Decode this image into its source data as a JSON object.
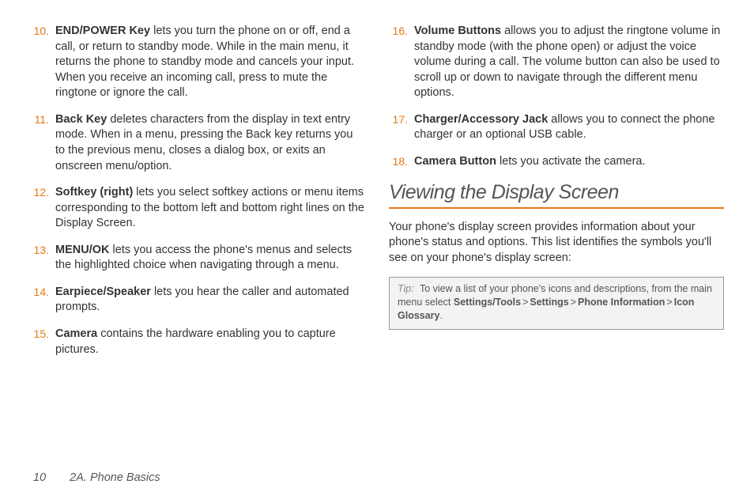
{
  "left_column": [
    {
      "num": "10.",
      "key": "END/POWER Key",
      "text": " lets you turn the phone on or off, end a call, or return to standby mode. While in the main menu, it returns the phone to standby mode and cancels your input. When you receive an incoming call, press to mute the ringtone or ignore the call."
    },
    {
      "num": "11.",
      "key": "Back Key",
      "text": " deletes characters from the display in text entry mode. When in a menu, pressing the Back key returns you to the previous menu, closes a dialog box, or exits an onscreen menu/option."
    },
    {
      "num": "12.",
      "key": "Softkey (right)",
      "text": " lets you select softkey actions or menu items corresponding to the bottom left and bottom right lines on the Display Screen."
    },
    {
      "num": "13.",
      "key": "MENU/OK",
      "text": " lets you access the phone's menus and selects the highlighted choice when navigating through a menu."
    },
    {
      "num": "14.",
      "key": "Earpiece/Speaker",
      "text": " lets you hear the caller and automated prompts."
    },
    {
      "num": "15.",
      "key": "Camera",
      "text": " contains the hardware enabling you to capture pictures."
    }
  ],
  "right_column": [
    {
      "num": "16.",
      "key": "Volume Buttons",
      "text": " allows you to adjust the ringtone volume in standby mode (with the phone open) or adjust the voice volume during a call. The volume button can also be used to scroll up or down to navigate through the different menu options."
    },
    {
      "num": "17.",
      "key": "Charger/Accessory Jack",
      "text": " allows you to connect the phone charger or an optional USB cable."
    },
    {
      "num": "18.",
      "key": "Camera Button",
      "text": " lets you activate the camera."
    }
  ],
  "section_heading": "Viewing the Display Screen",
  "section_intro": "Your phone's display screen provides information about your phone's status and options. This list identifies the symbols you'll see on your phone's display screen:",
  "tip": {
    "label": "Tip:",
    "lead": "To view a list of your phone's icons and descriptions, from the main menu select ",
    "path1": "Settings/Tools",
    "path2": "Settings",
    "path3": "Phone Information",
    "path4": "Icon Glossary",
    "trail": "."
  },
  "footer": {
    "page": "10",
    "chapter": "2A. Phone Basics"
  }
}
